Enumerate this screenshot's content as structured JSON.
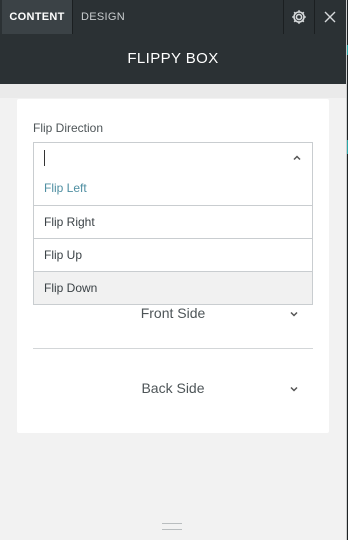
{
  "tabs": [
    {
      "label": "CONTENT",
      "active": true
    },
    {
      "label": "DESIGN",
      "active": false
    }
  ],
  "icons": {
    "settings": "gear-icon",
    "close": "close-icon",
    "select_toggle": "chevron-up-icon",
    "section_toggle": "chevron-down-icon",
    "resize": "resize-grip-icon"
  },
  "header": {
    "title": "FLIPPY BOX"
  },
  "form": {
    "flip_direction": {
      "label": "Flip Direction",
      "value": "",
      "options": [
        "Flip Left",
        "Flip Right",
        "Flip Up",
        "Flip Down"
      ],
      "highlighted_option": "Flip Left",
      "hovered_option": "Flip Down"
    },
    "sections": [
      {
        "label": "Front Side"
      },
      {
        "label": "Back Side"
      }
    ]
  },
  "colors": {
    "topbar": "#2b3134",
    "highlight": "#4f8fa2",
    "panel": "#ffffff"
  }
}
